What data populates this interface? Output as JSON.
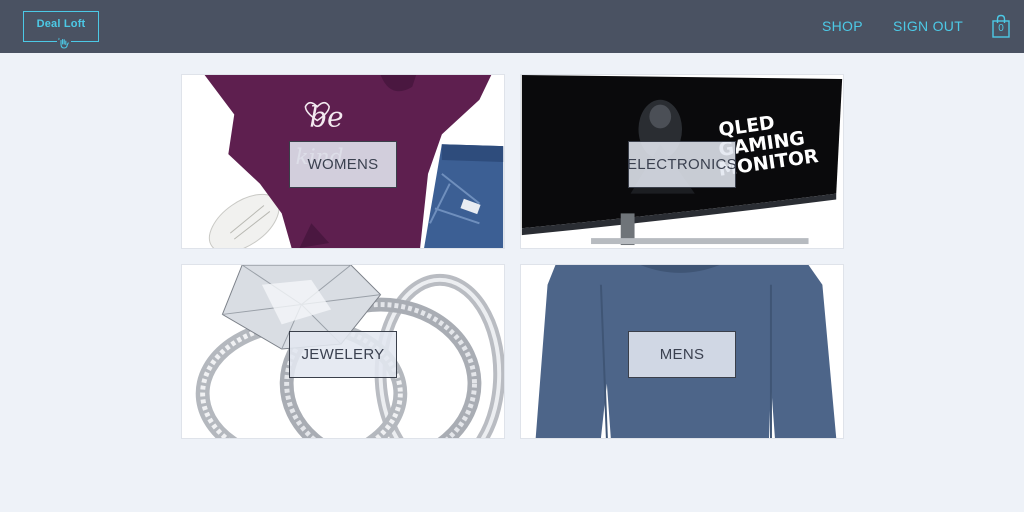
{
  "navbar": {
    "logo_text": "Deal Loft",
    "links": [
      {
        "label": "SHOP"
      },
      {
        "label": "SIGN OUT"
      }
    ],
    "cart_count": "0"
  },
  "categories": [
    {
      "label": "WOMENS"
    },
    {
      "label": "ELECTRONICS"
    },
    {
      "label": "JEWELERY"
    },
    {
      "label": "MENS"
    }
  ],
  "image_texts": {
    "shirt_text": "be",
    "shirt_text_2": "kind",
    "monitor_text_1": "QLED",
    "monitor_text_2": "GAMING",
    "monitor_text_3": "MONITOR"
  },
  "colors": {
    "navbar_bg": "#4a5262",
    "accent": "#4cc9e6",
    "page_bg": "#eef2f8"
  },
  "icons": [
    "waving-hand-icon",
    "shopping-bag-icon"
  ]
}
